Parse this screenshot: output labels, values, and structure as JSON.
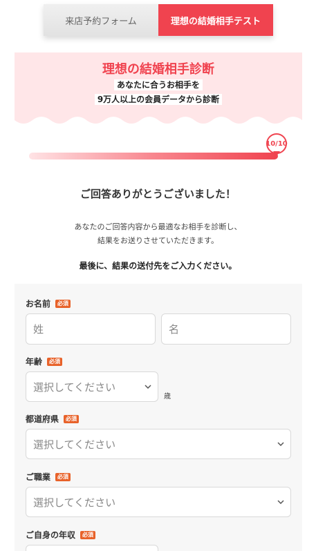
{
  "tabs": [
    {
      "label": "来店予約フォーム"
    },
    {
      "label": "理想の結婚相手テスト"
    }
  ],
  "hero": {
    "title": "理想の結婚相手診断",
    "subtitle_line1": "あなたに合うお相手を",
    "subtitle_line2": "9万人以上の会員データから診断"
  },
  "progress": {
    "label": "10/10",
    "current": 10,
    "total": 10
  },
  "thanks": "ご回答ありがとうございました！",
  "description": {
    "line1": "あなたのご回答内容から最適なお相手を診断し、",
    "line2": "結果をお送りさせていただきます。"
  },
  "lead": "最後に、結果の送付先をご入力ください。",
  "form": {
    "required_badge": "必須",
    "name": {
      "label": "お名前",
      "last_placeholder": "姓",
      "first_placeholder": "名"
    },
    "age": {
      "label": "年齢",
      "value": "選択してください",
      "unit": "歳"
    },
    "prefecture": {
      "label": "都道府県",
      "value": "選択してください"
    },
    "occupation": {
      "label": "ご職業",
      "value": "選択してください"
    },
    "income": {
      "label": "ご自身の年収"
    }
  },
  "colors": {
    "accent": "#f0434f",
    "hero_bg": "#ffe6e8",
    "badge": "#e8622a"
  }
}
